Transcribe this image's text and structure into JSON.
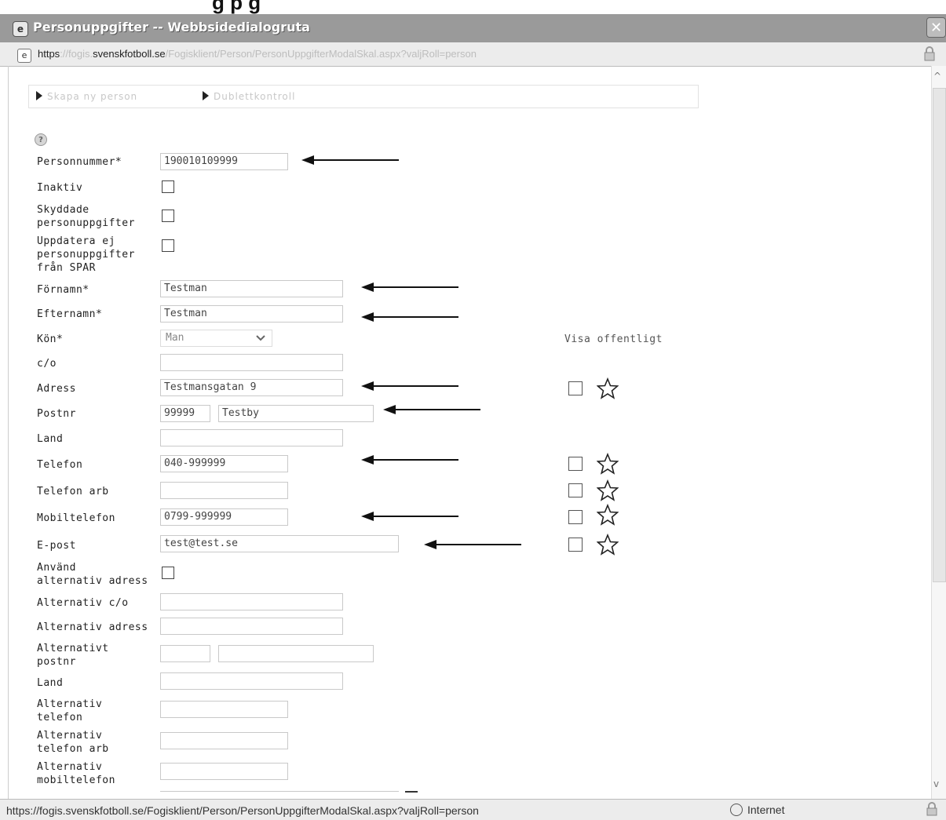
{
  "window": {
    "title": "Personuppgifter -- Webbsidedialogruta",
    "close": "✕"
  },
  "address": {
    "scheme": "https",
    "sep": "://",
    "sub": "fogis.",
    "domain": "svenskfotboll.se",
    "path": "/Fogisklient/Person/PersonUppgifterModalSkal.aspx?valjRoll=person"
  },
  "toolbar": {
    "create": "Skapa ny person",
    "dup": "Dublettkontroll"
  },
  "form": {
    "personnummer_label": "Personnummer*",
    "personnummer": "190010109999",
    "inaktiv_label": "Inaktiv",
    "skyddade_label1": "Skyddade",
    "skyddade_label2": "personuppgifter",
    "uppdatera_label1": "Uppdatera ej",
    "uppdatera_label2": "personuppgifter",
    "uppdatera_label3": "från SPAR",
    "fornamn_label": "Förnamn*",
    "fornamn": "Testman",
    "efternamn_label": "Efternamn*",
    "efternamn": "Testman",
    "kon_label": "Kön*",
    "kon": "Man",
    "visa_label": "Visa offentligt",
    "co_label": "c/o",
    "adress_label": "Adress",
    "adress": "Testmansgatan 9",
    "postnr_label": "Postnr",
    "postnr": "99999",
    "ort": "Testby",
    "land_label": "Land",
    "telefon_label": "Telefon",
    "telefon": "040-999999",
    "telefonarb_label": "Telefon arb",
    "mobil_label": "Mobiltelefon",
    "mobil": "0799-999999",
    "epost_label": "E-post",
    "epost": "test@test.se",
    "anvand_label1": "Använd",
    "anvand_label2": "alternativ adress",
    "altco_label": "Alternativ c/o",
    "altadress_label": "Alternativ adress",
    "altpostnr_label1": "Alternativt",
    "altpostnr_label2": "postnr",
    "altland_label": "Land",
    "alttel_label1": "Alternativ",
    "alttel_label2": "telefon",
    "alttelarb_label1": "Alternativ",
    "alttelarb_label2": "telefon arb",
    "altmobil_label1": "Alternativ",
    "altmobil_label2": "mobiltelefon"
  },
  "status": {
    "url": "https://fogis.svenskfotboll.se/Fogisklient/Person/PersonUppgifterModalSkal.aspx?valjRoll=person",
    "zone": "Internet"
  },
  "colors": {
    "titlebar": "#9a9a9a",
    "arrow": "#111111"
  },
  "icons": [
    "ie-page-icon",
    "lock-icon",
    "help-icon",
    "star-icon",
    "arrow-left-icon",
    "chevron-down-icon",
    "globe-icon"
  ]
}
